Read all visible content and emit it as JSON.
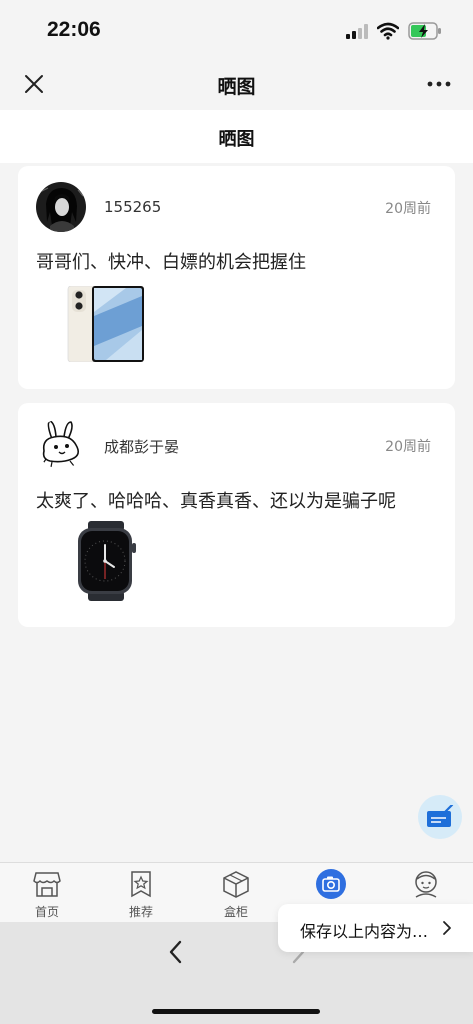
{
  "status_bar": {
    "time": "22:06"
  },
  "nav": {
    "title": "晒图"
  },
  "page": {
    "title": "晒图"
  },
  "posts": [
    {
      "username": "155265",
      "time_ago": "20周前",
      "text": "哥哥们、快冲、白嫖的机会把握住"
    },
    {
      "username": "成都彭于晏",
      "time_ago": "20周前",
      "text": "太爽了、哈哈哈、真香真香、还以为是骗子呢"
    }
  ],
  "tabs": [
    {
      "label": "首页",
      "icon": "shop-icon"
    },
    {
      "label": "推荐",
      "icon": "star-badge-icon"
    },
    {
      "label": "盒柜",
      "icon": "box-icon"
    },
    {
      "label": "",
      "icon": "camera-icon"
    },
    {
      "label": "",
      "icon": "user-face-icon"
    }
  ],
  "save_popup": {
    "text": "保存以上内容为…"
  },
  "colors": {
    "accent": "#2f6fe0",
    "background": "#f4f4f4",
    "card": "#ffffff"
  }
}
